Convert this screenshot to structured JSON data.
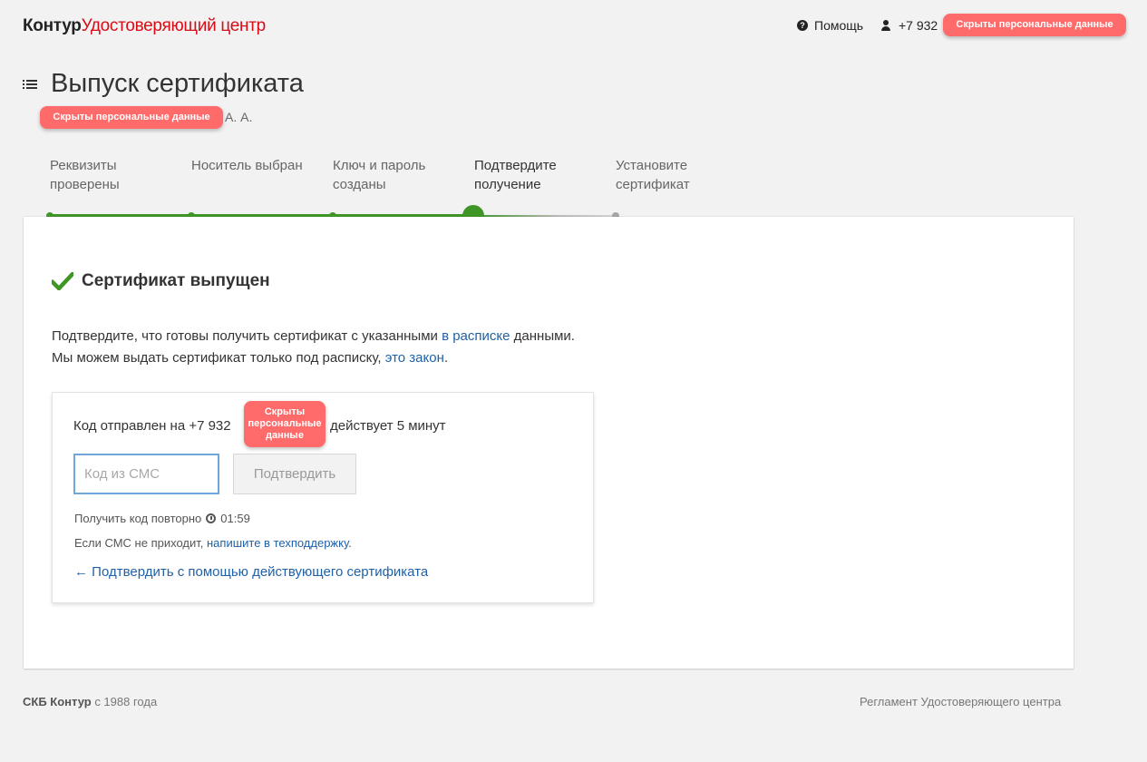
{
  "header": {
    "brand": "Контур",
    "product": "Удостоверяющий центр",
    "help_label": "Помощь",
    "user_phone": "+7 932 ",
    "redacted_label": "Скрыты персональные данные"
  },
  "page": {
    "title": "Выпуск сертификата",
    "owner_redacted": "Скрыты персональные данные",
    "owner_suffix": "А. А."
  },
  "steps": [
    {
      "label": "Реквизиты проверены",
      "state": "done"
    },
    {
      "label": "Носитель выбран",
      "state": "done"
    },
    {
      "label": "Ключ и пароль созданы",
      "state": "done"
    },
    {
      "label": "Подтвердите получение",
      "state": "current"
    },
    {
      "label": "Установите сертификат",
      "state": "future"
    }
  ],
  "status": {
    "icon": "check-icon",
    "title": "Сертификат выпущен",
    "color": "#3f9626"
  },
  "description": {
    "line1_before": "Подтвердите, что готовы получить сертификат с указанными ",
    "line1_link": "в расписке",
    "line1_after": " данными.",
    "line2_before": "Мы можем выдать сертификат только под расписку, ",
    "line2_link": "это закон",
    "line2_after": "."
  },
  "sms": {
    "sent_prefix": "Код отправлен на +7 932 ",
    "redacted_label": "Скрыты персональные данные",
    "sent_suffix": "действует 5 минут",
    "input_placeholder": "Код из СМС",
    "input_value": "",
    "confirm_label": "Подтвердить",
    "resend_label": "Получить код повторно",
    "resend_timer": "01:59",
    "support_text": "Если СМС не приходит, ",
    "support_link": "напишите в техподдержку",
    "support_after": ".",
    "alt_link": "← Подтвердить с помощью действующего сертификата"
  },
  "footer": {
    "company": "СКБ Контур",
    "since": " с 1988 года",
    "regulation_link": "Регламент Удостоверяющего центра"
  },
  "colors": {
    "accent_red": "#d70c17",
    "link_blue": "#1f61a8",
    "success_green": "#3f9626",
    "redaction": "#ff6b6b"
  }
}
